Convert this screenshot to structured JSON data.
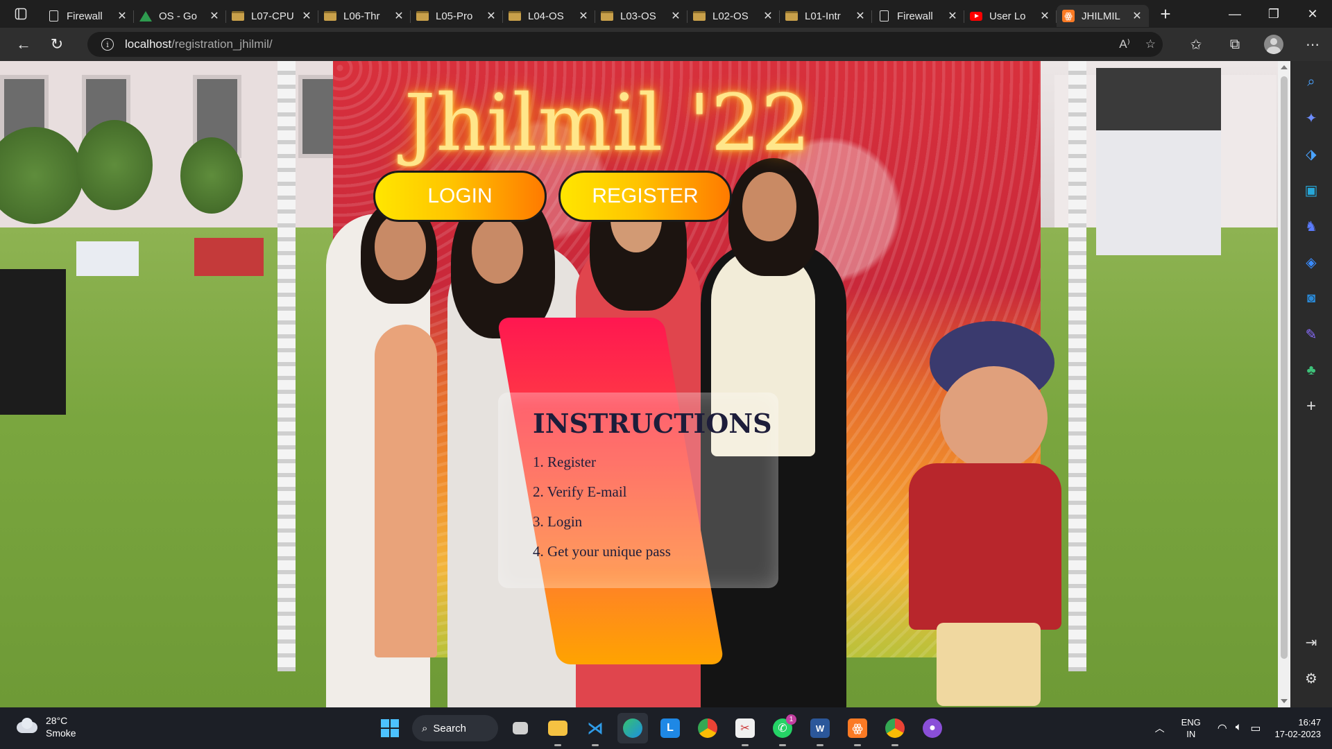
{
  "browser": {
    "tabs": [
      {
        "title": "Firewall",
        "favicon": "page-icon"
      },
      {
        "title": "OS - Go",
        "favicon": "drive-icon"
      },
      {
        "title": "L07-CPU",
        "favicon": "folder-icon"
      },
      {
        "title": "L06-Thr",
        "favicon": "folder-icon"
      },
      {
        "title": "L05-Pro",
        "favicon": "folder-icon"
      },
      {
        "title": "L04-OS",
        "favicon": "folder-icon"
      },
      {
        "title": "L03-OS",
        "favicon": "folder-icon"
      },
      {
        "title": "L02-OS",
        "favicon": "folder-icon"
      },
      {
        "title": "L01-Intr",
        "favicon": "folder-icon"
      },
      {
        "title": "Firewall",
        "favicon": "page-icon"
      },
      {
        "title": "User Lo",
        "favicon": "youtube-icon"
      },
      {
        "title": "JHILMIL",
        "favicon": "xampp-icon",
        "active": true
      }
    ],
    "url_host": "localhost",
    "url_path": "/registration_jhilmil/"
  },
  "page": {
    "title": "Jhilmil '22",
    "login_label": "LOGIN",
    "register_label": "REGISTER",
    "instructions": {
      "heading": "INSTRUCTIONS",
      "steps": [
        "1. Register",
        "2. Verify E-mail",
        "3. Login",
        "4. Get your unique pass"
      ]
    },
    "colors": {
      "title_glow": "#ffb020",
      "button_gradient_start": "#ffe600",
      "button_gradient_end": "#ff7a00",
      "instructions_gradient_start": "#ff1750",
      "instructions_gradient_end": "#ffa300"
    }
  },
  "taskbar": {
    "weather_temp": "28°C",
    "weather_desc": "Smoke",
    "search_label": "Search",
    "lang_line1": "ENG",
    "lang_line2": "IN",
    "time": "16:47",
    "date": "17-02-2023",
    "whatsapp_badge": "1"
  }
}
